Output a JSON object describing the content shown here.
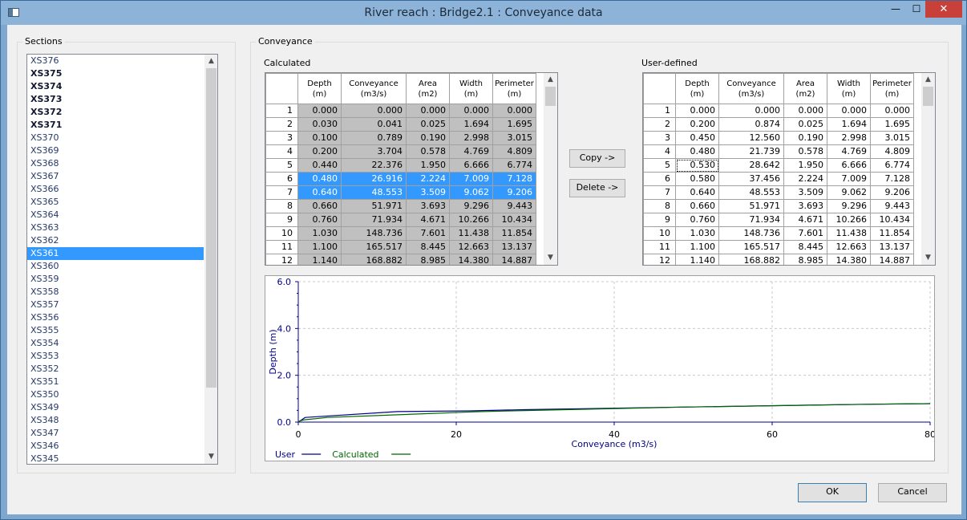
{
  "window": {
    "title": "River reach : Bridge2.1 : Conveyance data",
    "min": "—",
    "max": "☐",
    "close": "✕"
  },
  "sections": {
    "label": "Sections",
    "items": [
      {
        "label": "XS376",
        "bold": false,
        "selected": false
      },
      {
        "label": "XS375",
        "bold": true,
        "selected": false
      },
      {
        "label": "XS374",
        "bold": true,
        "selected": false
      },
      {
        "label": "XS373",
        "bold": true,
        "selected": false
      },
      {
        "label": "XS372",
        "bold": true,
        "selected": false
      },
      {
        "label": "XS371",
        "bold": true,
        "selected": false
      },
      {
        "label": "XS370",
        "bold": false,
        "selected": false
      },
      {
        "label": "XS369",
        "bold": false,
        "selected": false
      },
      {
        "label": "XS368",
        "bold": false,
        "selected": false
      },
      {
        "label": "XS367",
        "bold": false,
        "selected": false
      },
      {
        "label": "XS366",
        "bold": false,
        "selected": false
      },
      {
        "label": "XS365",
        "bold": false,
        "selected": false
      },
      {
        "label": "XS364",
        "bold": false,
        "selected": false
      },
      {
        "label": "XS363",
        "bold": false,
        "selected": false
      },
      {
        "label": "XS362",
        "bold": false,
        "selected": false
      },
      {
        "label": "XS361",
        "bold": false,
        "selected": true
      },
      {
        "label": "XS360",
        "bold": false,
        "selected": false
      },
      {
        "label": "XS359",
        "bold": false,
        "selected": false
      },
      {
        "label": "XS358",
        "bold": false,
        "selected": false
      },
      {
        "label": "XS357",
        "bold": false,
        "selected": false
      },
      {
        "label": "XS356",
        "bold": false,
        "selected": false
      },
      {
        "label": "XS355",
        "bold": false,
        "selected": false
      },
      {
        "label": "XS354",
        "bold": false,
        "selected": false
      },
      {
        "label": "XS353",
        "bold": false,
        "selected": false
      },
      {
        "label": "XS352",
        "bold": false,
        "selected": false
      },
      {
        "label": "XS351",
        "bold": false,
        "selected": false
      },
      {
        "label": "XS350",
        "bold": false,
        "selected": false
      },
      {
        "label": "XS349",
        "bold": false,
        "selected": false
      },
      {
        "label": "XS348",
        "bold": false,
        "selected": false
      },
      {
        "label": "XS347",
        "bold": false,
        "selected": false
      },
      {
        "label": "XS346",
        "bold": false,
        "selected": false
      },
      {
        "label": "XS345",
        "bold": false,
        "selected": false
      }
    ]
  },
  "conveyance": {
    "label": "Conveyance"
  },
  "columns": [
    {
      "name": "Depth",
      "unit": "(m)"
    },
    {
      "name": "Conveyance",
      "unit": "(m3/s)"
    },
    {
      "name": "Area",
      "unit": "(m2)"
    },
    {
      "name": "Width",
      "unit": "(m)"
    },
    {
      "name": "Perimeter",
      "unit": "(m)"
    }
  ],
  "calculated": {
    "label": "Calculated",
    "selected_rows": [
      6,
      7
    ],
    "rows": [
      [
        "1",
        "0.000",
        "0.000",
        "0.000",
        "0.000",
        "0.000"
      ],
      [
        "2",
        "0.030",
        "0.041",
        "0.025",
        "1.694",
        "1.695"
      ],
      [
        "3",
        "0.100",
        "0.789",
        "0.190",
        "2.998",
        "3.015"
      ],
      [
        "4",
        "0.200",
        "3.704",
        "0.578",
        "4.769",
        "4.809"
      ],
      [
        "5",
        "0.440",
        "22.376",
        "1.950",
        "6.666",
        "6.774"
      ],
      [
        "6",
        "0.480",
        "26.916",
        "2.224",
        "7.009",
        "7.128"
      ],
      [
        "7",
        "0.640",
        "48.553",
        "3.509",
        "9.062",
        "9.206"
      ],
      [
        "8",
        "0.660",
        "51.971",
        "3.693",
        "9.296",
        "9.443"
      ],
      [
        "9",
        "0.760",
        "71.934",
        "4.671",
        "10.266",
        "10.434"
      ],
      [
        "10",
        "1.030",
        "148.736",
        "7.601",
        "11.438",
        "11.854"
      ],
      [
        "11",
        "1.100",
        "165.517",
        "8.445",
        "12.663",
        "13.137"
      ],
      [
        "12",
        "1.140",
        "168.882",
        "8.985",
        "14.380",
        "14.887"
      ]
    ]
  },
  "user_defined": {
    "label": "User-defined",
    "rows": [
      [
        "1",
        "0.000",
        "0.000",
        "0.000",
        "0.000",
        "0.000"
      ],
      [
        "2",
        "0.200",
        "0.874",
        "0.025",
        "1.694",
        "1.695"
      ],
      [
        "3",
        "0.450",
        "12.560",
        "0.190",
        "2.998",
        "3.015"
      ],
      [
        "4",
        "0.480",
        "21.739",
        "0.578",
        "4.769",
        "4.809"
      ],
      [
        "5",
        "0.530",
        "28.642",
        "1.950",
        "6.666",
        "6.774"
      ],
      [
        "6",
        "0.580",
        "37.456",
        "2.224",
        "7.009",
        "7.128"
      ],
      [
        "7",
        "0.640",
        "48.553",
        "3.509",
        "9.062",
        "9.206"
      ],
      [
        "8",
        "0.660",
        "51.971",
        "3.693",
        "9.296",
        "9.443"
      ],
      [
        "9",
        "0.760",
        "71.934",
        "4.671",
        "10.266",
        "10.434"
      ],
      [
        "10",
        "1.030",
        "148.736",
        "7.601",
        "11.438",
        "11.854"
      ],
      [
        "11",
        "1.100",
        "165.517",
        "8.445",
        "12.663",
        "13.137"
      ],
      [
        "12",
        "1.140",
        "168.882",
        "8.985",
        "14.380",
        "14.887"
      ]
    ]
  },
  "buttons": {
    "copy": "Copy ->",
    "delete": "Delete ->",
    "ok": "OK",
    "cancel": "Cancel"
  },
  "colors": {
    "selection": "#3399ff",
    "user_series": "#00008b",
    "calculated_series": "#006400",
    "axis": "#00008b"
  },
  "chart_data": {
    "type": "line",
    "xlabel": "Conveyance (m3/s)",
    "ylabel": "Depth (m)",
    "xlim": [
      0,
      80
    ],
    "ylim": [
      0,
      6
    ],
    "xticks": [
      0,
      20,
      40,
      60,
      80
    ],
    "yticks": [
      0.0,
      2.0,
      4.0,
      6.0
    ],
    "xtick_labels": [
      "0",
      "20",
      "40",
      "60",
      "80"
    ],
    "ytick_labels": [
      "0.0",
      "2.0",
      "4.0",
      "6.0"
    ],
    "grid": true,
    "legend_position": "bottom-left",
    "series": [
      {
        "name": "User",
        "color": "#00008b",
        "x": [
          0,
          0.874,
          12.56,
          21.739,
          28.642,
          37.456,
          48.553,
          51.971,
          71.934,
          80
        ],
        "y": [
          0,
          0.2,
          0.45,
          0.48,
          0.53,
          0.58,
          0.64,
          0.66,
          0.76,
          0.79
        ]
      },
      {
        "name": "Calculated",
        "color": "#006400",
        "x": [
          0,
          0.041,
          0.789,
          3.704,
          22.376,
          26.916,
          48.553,
          51.971,
          71.934,
          80
        ],
        "y": [
          0,
          0.03,
          0.1,
          0.2,
          0.44,
          0.48,
          0.64,
          0.66,
          0.76,
          0.79
        ]
      }
    ]
  }
}
